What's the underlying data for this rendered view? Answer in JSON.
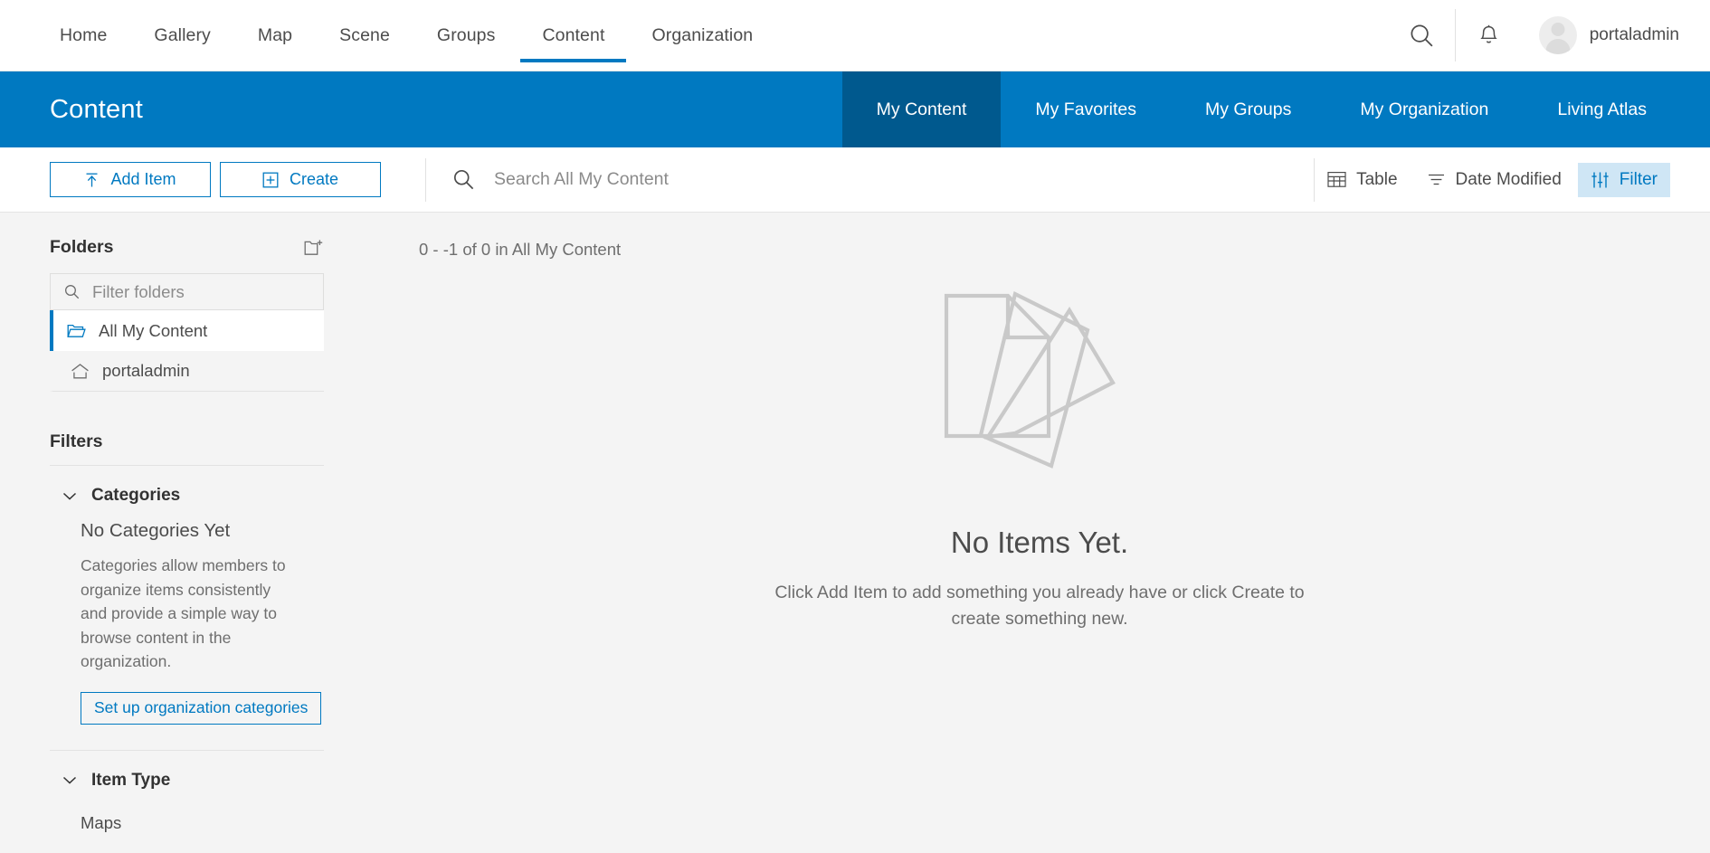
{
  "topnav": {
    "links": [
      {
        "label": "Home",
        "active": false
      },
      {
        "label": "Gallery",
        "active": false
      },
      {
        "label": "Map",
        "active": false
      },
      {
        "label": "Scene",
        "active": false
      },
      {
        "label": "Groups",
        "active": false
      },
      {
        "label": "Content",
        "active": true
      },
      {
        "label": "Organization",
        "active": false
      }
    ],
    "search_icon": "search-icon",
    "notification_icon": "bell-icon",
    "avatar_icon": "avatar",
    "username": "portaladmin"
  },
  "subheader": {
    "title": "Content",
    "tabs": [
      {
        "label": "My Content",
        "active": true
      },
      {
        "label": "My Favorites",
        "active": false
      },
      {
        "label": "My Groups",
        "active": false
      },
      {
        "label": "My Organization",
        "active": false
      },
      {
        "label": "Living Atlas",
        "active": false
      }
    ],
    "bg_color": "#0079c1",
    "active_tab_color": "#00598e"
  },
  "toolbar": {
    "add_item_label": "Add Item",
    "add_item_icon": "upload-icon",
    "create_label": "Create",
    "create_icon": "plus-square-icon",
    "search_placeholder": "Search All My Content",
    "search_value": "",
    "search_icon": "search-icon",
    "view_label": "Table",
    "view_icon": "table-icon",
    "sort_label": "Date Modified",
    "sort_icon": "sort-icon",
    "filter_label": "Filter",
    "filter_icon": "sliders-icon",
    "filter_highlight_color": "#cfe6f5",
    "accent_color": "#0079c1"
  },
  "sidebar": {
    "folders_title": "Folders",
    "new_folder_icon": "new-folder-icon",
    "folder_filter_placeholder": "Filter folders",
    "folder_filter_value": "",
    "folder_search_icon": "search-icon",
    "folders": [
      {
        "label": "All My Content",
        "icon": "open-folder-icon",
        "active": true
      },
      {
        "label": "portaladmin",
        "icon": "home-icon",
        "active": false
      }
    ],
    "filters_title": "Filters",
    "categories": {
      "facet_label": "Categories",
      "chevron_icon": "chevron-down-icon",
      "empty_title": "No Categories Yet",
      "empty_text": "Categories allow members to organize items consistently and provide a simple way to browse content in the organization.",
      "setup_button": "Set up organization categories"
    },
    "item_type": {
      "facet_label": "Item Type",
      "chevron_icon": "chevron-down-icon",
      "items": [
        {
          "label": "Maps"
        }
      ]
    }
  },
  "main": {
    "result_count": "0 - -1 of 0 in All My Content",
    "empty_illustration": "documents-icon",
    "empty_title": "No Items Yet.",
    "empty_subtitle": "Click Add Item to add something you already have or click Create to create something new."
  }
}
